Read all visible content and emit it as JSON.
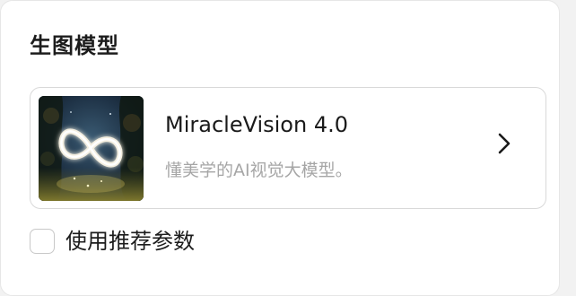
{
  "section": {
    "title": "生图模型"
  },
  "model_card": {
    "name": "MiracleVision 4.0",
    "description": "懂美学的AI视觉大模型。",
    "thumbnail_icon": "infinity-logo-icon",
    "chevron_icon": "chevron-right-icon"
  },
  "option": {
    "label": "使用推荐参数",
    "checked": false
  },
  "colors": {
    "title_text": "#1c1c1c",
    "description_text": "#a6a6a6",
    "card_border": "#d9d9d9",
    "checkbox_border": "#c8c8c8"
  }
}
